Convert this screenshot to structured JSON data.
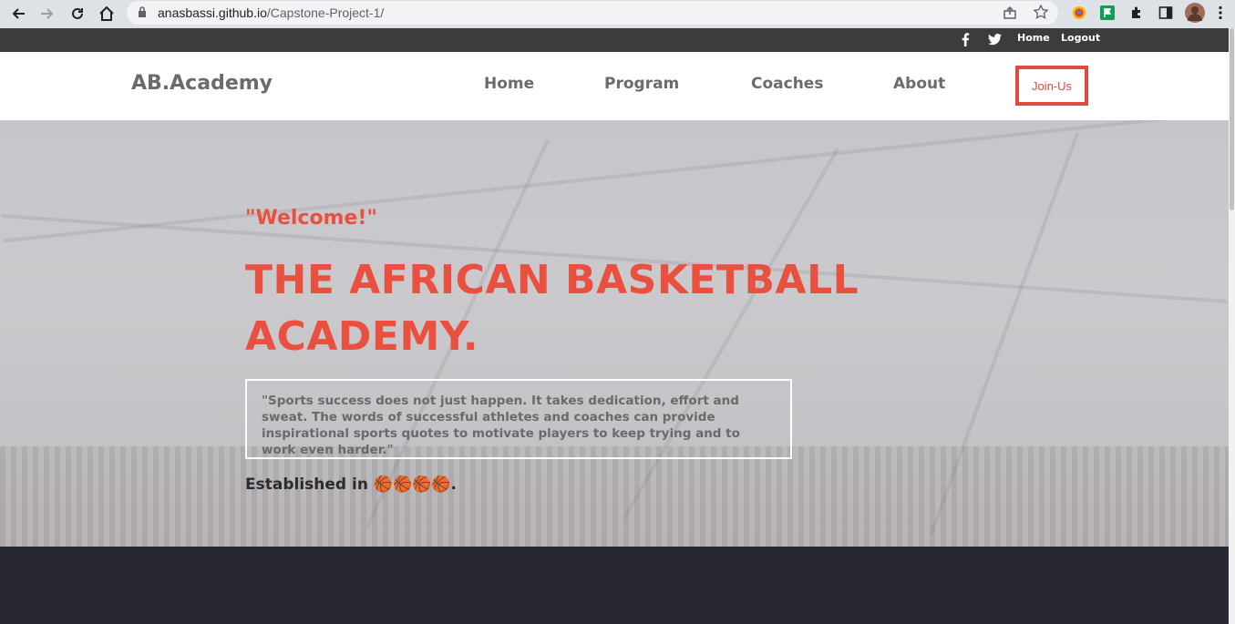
{
  "browser": {
    "url_host": "anasbassi.github.io",
    "url_path": "/Capstone-Project-1/"
  },
  "topbar": {
    "home": "Home",
    "logout": "Logout",
    "icons": [
      "facebook-icon",
      "twitter-icon"
    ]
  },
  "header": {
    "logo": "AB.Academy",
    "menu": [
      "Home",
      "Program",
      "Coaches",
      "About"
    ],
    "join": "Join-Us"
  },
  "hero": {
    "welcome": "\"Welcome!\"",
    "headline": "THE AFRICAN BASKETBALL ACADEMY.",
    "quote": "\"Sports success does not just happen. It takes dedication, effort and sweat. The words of successful athletes and coaches can provide inspirational sports quotes to motivate players to keep trying and to work even harder.\"",
    "established": "Established in 🏀🏀🏀🏀."
  },
  "colors": {
    "accent": "#e9503f",
    "topbar": "#3c3c3c",
    "dark_section": "#272831"
  }
}
